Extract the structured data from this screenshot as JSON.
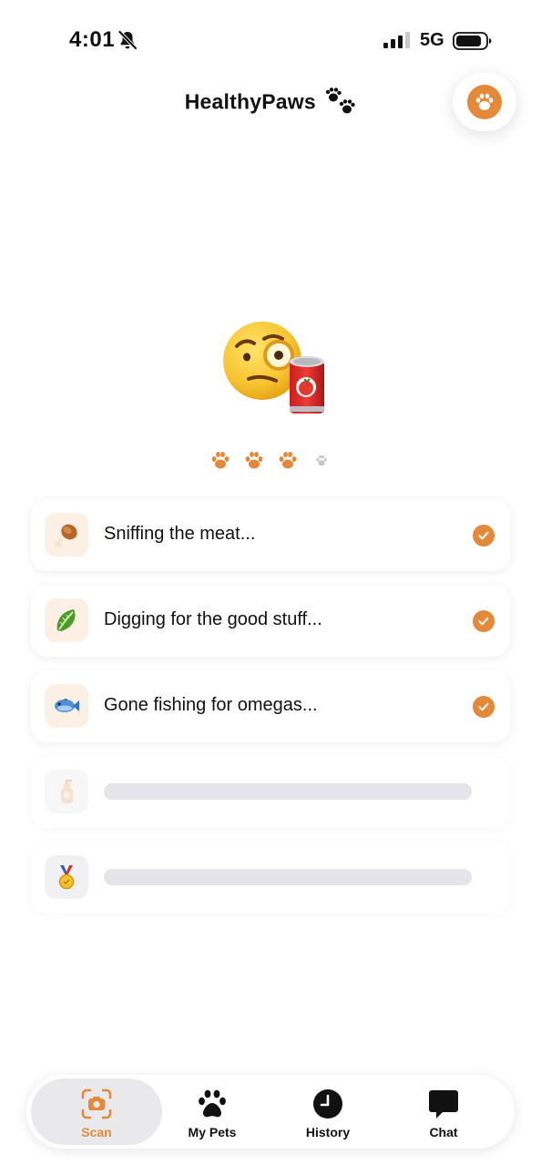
{
  "status_bar": {
    "time": "4:01",
    "network": "5G",
    "icons": [
      "bell-muted-icon",
      "signal-icon",
      "battery-icon"
    ]
  },
  "header": {
    "title": "HealthyPaws",
    "title_icon": "paw-prints-icon",
    "profile_icon": "paw-icon"
  },
  "scan": {
    "illustration": [
      "monocle-face-icon",
      "can-icon"
    ],
    "progress_dots": {
      "filled": 3,
      "total": 4
    },
    "steps": [
      {
        "icon": "drumstick-icon",
        "label": "Sniffing the meat...",
        "done": true
      },
      {
        "icon": "lettuce-icon",
        "label": "Digging for the good stuff...",
        "done": true
      },
      {
        "icon": "fish-icon",
        "label": "Gone fishing for omegas...",
        "done": true
      },
      {
        "icon": "lotion-bottle-icon",
        "label": "",
        "done": false
      },
      {
        "icon": "medal-icon",
        "label": "",
        "done": false
      }
    ]
  },
  "tab_bar": {
    "tabs": [
      {
        "label": "Scan",
        "icon": "camera-scan-icon",
        "active": true
      },
      {
        "label": "My Pets",
        "icon": "paw-icon",
        "active": false
      },
      {
        "label": "History",
        "icon": "clock-icon",
        "active": false
      },
      {
        "label": "Chat",
        "icon": "chat-bubble-icon",
        "active": false
      }
    ]
  },
  "colors": {
    "accent": "#E4893A",
    "icon_tile": "#FCEFE4",
    "skeleton": "#E4E4EA",
    "active_tab": "#E9E9EB"
  }
}
